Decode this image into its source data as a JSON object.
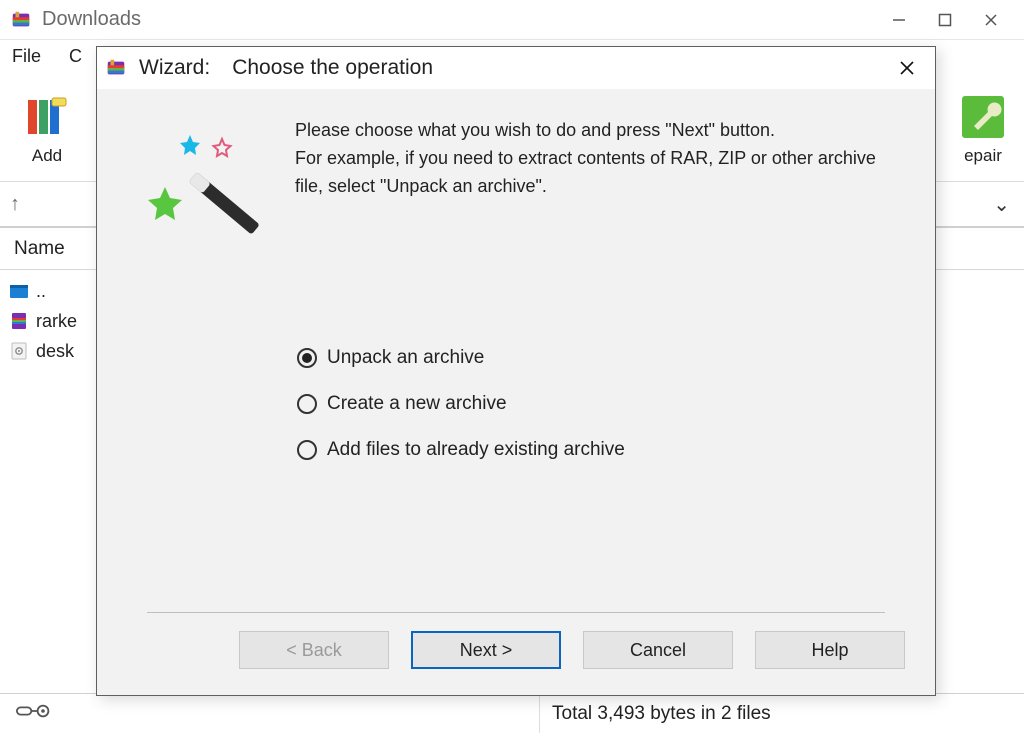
{
  "main_window": {
    "title": "Downloads",
    "menu": {
      "file": "File",
      "second": "C"
    },
    "toolbar": {
      "add_label": "Add",
      "repair_label": "epair"
    },
    "list_header": {
      "name": "Name"
    },
    "files": [
      {
        "label": ".."
      },
      {
        "label": "rarke"
      },
      {
        "label": "desk"
      }
    ],
    "statusbar": {
      "total": "Total 3,493 bytes in 2 files"
    }
  },
  "dialog": {
    "title_prefix": "Wizard:",
    "title_op": "Choose the operation",
    "intro_line1": "Please choose what you wish to do and press \"Next\" button.",
    "intro_line2": "For example, if you need to extract contents of RAR, ZIP or other archive file, select \"Unpack an archive\".",
    "options": [
      {
        "label": "Unpack an archive",
        "selected": true
      },
      {
        "label": "Create a new archive",
        "selected": false
      },
      {
        "label": "Add files to already existing archive",
        "selected": false
      }
    ],
    "buttons": {
      "back": "< Back",
      "next": "Next >",
      "cancel": "Cancel",
      "help": "Help"
    }
  }
}
